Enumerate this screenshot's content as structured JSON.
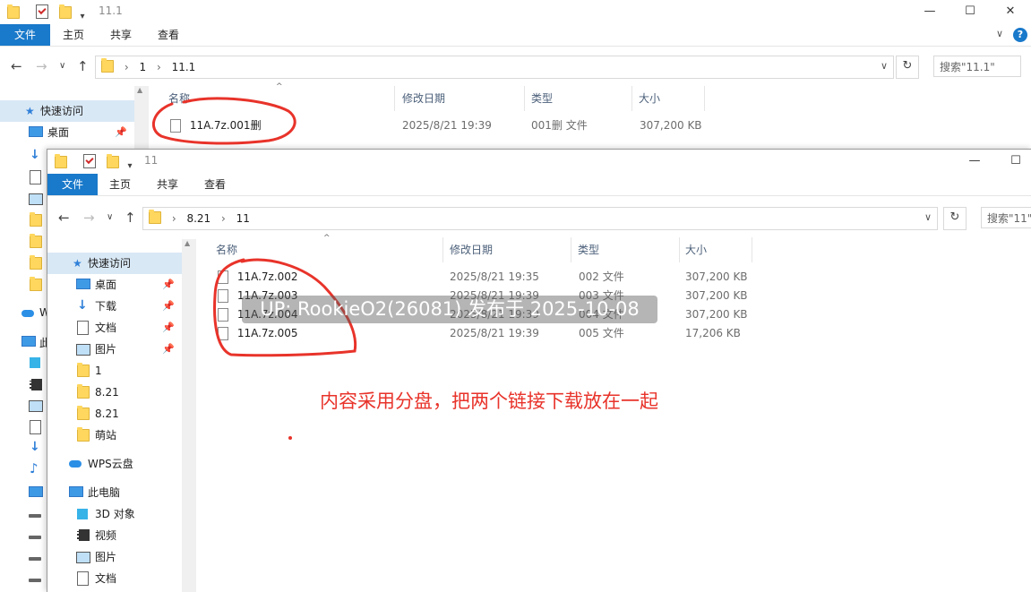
{
  "back_window": {
    "title": "11.1",
    "ribbon_tabs": [
      "文件",
      "主页",
      "共享",
      "查看"
    ],
    "controls": {
      "minimize": "—",
      "maximize": "☐",
      "close": "✕"
    },
    "breadcrumb": [
      "1",
      "11.1"
    ],
    "search_placeholder": "搜索\"11.1\"",
    "columns": {
      "name": "名称",
      "modified": "修改日期",
      "type": "类型",
      "size": "大小"
    },
    "files": [
      {
        "name": "11A.7z.001删",
        "modified": "2025/8/21 19:39",
        "type": "001删 文件",
        "size": "307,200 KB"
      }
    ],
    "nav": {
      "quick_access": "快速访问",
      "desktop": "桌面"
    }
  },
  "front_window": {
    "title": "11",
    "ribbon_tabs": [
      "文件",
      "主页",
      "共享",
      "查看"
    ],
    "controls": {
      "minimize": "—",
      "maximize": "☐"
    },
    "breadcrumb": [
      "8.21",
      "11"
    ],
    "search_placeholder": "搜索\"11\"",
    "columns": {
      "name": "名称",
      "modified": "修改日期",
      "type": "类型",
      "size": "大小"
    },
    "files": [
      {
        "name": "11A.7z.002",
        "modified": "2025/8/21 19:35",
        "type": "002 文件",
        "size": "307,200 KB"
      },
      {
        "name": "11A.7z.003",
        "modified": "2025/8/21 19:39",
        "type": "003 文件",
        "size": "307,200 KB"
      },
      {
        "name": "11A.7z.004",
        "modified": "2025/8/21 19:39",
        "type": "004 文件",
        "size": "307,200 KB"
      },
      {
        "name": "11A.7z.005",
        "modified": "2025/8/21 19:39",
        "type": "005 文件",
        "size": "17,206 KB"
      }
    ],
    "nav": {
      "quick_access": "快速访问",
      "desktop": "桌面",
      "downloads": "下载",
      "documents": "文档",
      "pictures": "图片",
      "folder_1": "1",
      "folder_821a": "8.21",
      "folder_821b": "8.21",
      "folder_station": "萌站",
      "wps_cloud": "WPS云盘",
      "this_pc": "此电脑",
      "objects_3d": "3D 对象",
      "videos": "视频",
      "pc_pictures": "图片",
      "pc_documents": "文档"
    }
  },
  "overlay": {
    "watermark": "UP: RookieO2(26081) 发布于 2025-10-08",
    "note": "内容采用分盘，把两个链接下载放在一起",
    "annotation_color": "#e8332a"
  },
  "back_nav_partial": {
    "cloud_label": "W",
    "pc_label": "此"
  }
}
